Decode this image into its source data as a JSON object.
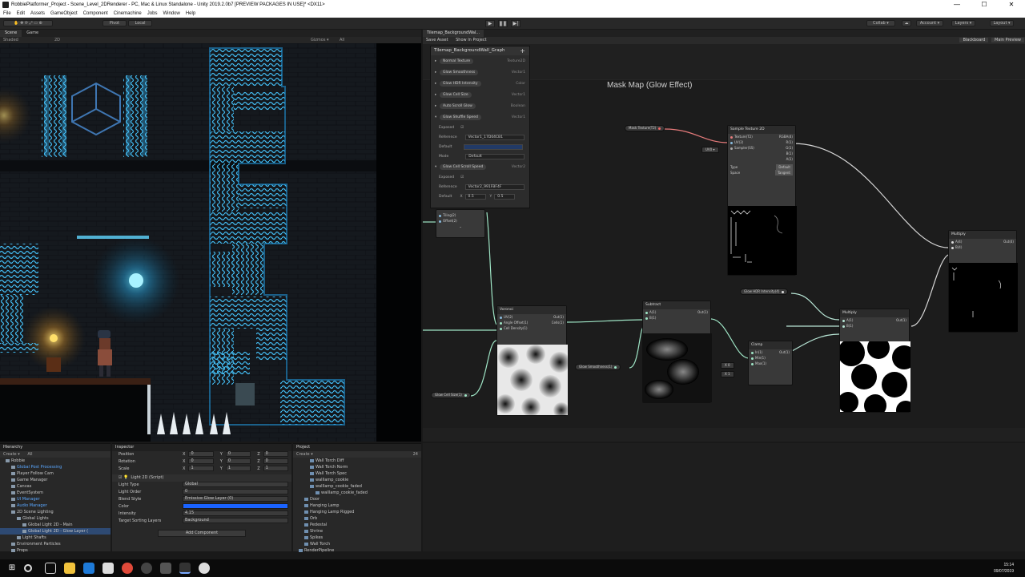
{
  "window": {
    "title": "RobbiePlatformer_Project - Scene_Level_2DRenderer - PC, Mac & Linux Standalone - Unity 2019.2.0b7 [PREVIEW PACKAGES IN USE]* <DX11>",
    "min": "—",
    "max": "☐",
    "close": "✕"
  },
  "menu": [
    "File",
    "Edit",
    "Assets",
    "GameObject",
    "Component",
    "Cinemachine",
    "Jobs",
    "Window",
    "Help"
  ],
  "toolbar": {
    "pivot": "Pivot",
    "local": "Local",
    "play": "▶",
    "pause": "❚❚",
    "step": "▶|",
    "collab": "Collab ▾",
    "account": "Account ▾",
    "layers": "Layers ▾",
    "layout": "Layout ▾"
  },
  "scene": {
    "tab_scene": "Scene",
    "tab_game": "Game",
    "shaded": "Shaded",
    "mode_2d": "2D",
    "gizmos": "Gizmos ▾",
    "search": "All"
  },
  "shader_graph": {
    "tab": "Tilemap_BackgroundWal...",
    "save": "Save Asset",
    "show": "Show In Project",
    "blackboard_btn": "Blackboard",
    "preview_btn": "Main Preview",
    "group_title": "Mask Map (Glow Effect)"
  },
  "blackboard": {
    "title": "Tilemap_BackgroundWall_Graph",
    "subtitle": "Shader Graphs",
    "plus": "+",
    "props": [
      {
        "name": "Normal Texture",
        "type": "Texture2D"
      },
      {
        "name": "Glow Smoothness",
        "type": "Vector1"
      },
      {
        "name": "Glow HDR Intensity",
        "type": "Color"
      },
      {
        "name": "Glow Cell Size",
        "type": "Vector1"
      },
      {
        "name": "Auto Scroll Glow",
        "type": "Boolean"
      },
      {
        "name": "Glow Shuffle Speed",
        "type": "Vector1"
      }
    ],
    "exposed": "Exposed",
    "reference": "Reference",
    "ref1": "Vector1_17D04CB1",
    "default": "Default",
    "mode": "Mode",
    "mode_val": "Default",
    "prop7": {
      "name": "Glow Cell Scroll Speed",
      "type": "Vector2"
    },
    "ref2": "Vector2_991FBF4F",
    "x": "X",
    "xval": "0.5",
    "y": "Y",
    "yval": "0.5"
  },
  "nodes": {
    "sample": {
      "title": "Sample Texture 2D",
      "texture": "Texture(T2)",
      "uv": "UV(2)",
      "sampler": "Sampler(SS)",
      "rgba": "RGBA(4)",
      "r": "R(1)",
      "g": "G(1)",
      "b": "B(1)",
      "a": "A(1)",
      "type": "Type",
      "type_val": "Default",
      "space": "Space",
      "space_val": "Tangent"
    },
    "voronoi": {
      "title": "Voronoi",
      "uv": "UV(2)",
      "angle": "Angle Offset(1)",
      "density": "Cell Density(1)",
      "out": "Out(1)",
      "cells": "Cells(1)"
    },
    "subtract": {
      "title": "Subtract",
      "a": "A(1)",
      "b": "B(1)",
      "out": "Out(1)"
    },
    "clamp": {
      "title": "Clamp",
      "in": "In(1)",
      "min": "Min(1)",
      "max": "Max(1)",
      "out": "Out(1)"
    },
    "multiply1": {
      "title": "Multiply",
      "a": "A(1)",
      "b": "B(1)",
      "out": "Out(1)"
    },
    "multiply2": {
      "title": "Multiply",
      "a": "A(4)",
      "b": "B(4)",
      "out": "Out(4)"
    },
    "tiling": {
      "tiling": "Tiling(2)",
      "offset": "Offset(2)"
    }
  },
  "pills": {
    "mask": "Mask Texture(T2)",
    "hdr": "Glow HDR Intensity(4)",
    "smooth": "Glow Smoothness(1)",
    "cellsize": "Glow Cell Size(1)",
    "uv0": "UV0 ▾",
    "x0": "X 0",
    "x1": "X 1"
  },
  "hierarchy": {
    "tab": "Hierarchy",
    "create": "Create ▾",
    "search": "All",
    "items": [
      {
        "label": "Robbie",
        "indent": 1,
        "style": ""
      },
      {
        "label": "Global Post Processing",
        "indent": 2,
        "style": "blue"
      },
      {
        "label": "Player Follow Cam",
        "indent": 2,
        "style": ""
      },
      {
        "label": "Game Manager",
        "indent": 2,
        "style": ""
      },
      {
        "label": "Canvas",
        "indent": 2,
        "style": ""
      },
      {
        "label": "EventSystem",
        "indent": 2,
        "style": ""
      },
      {
        "label": "UI Manager",
        "indent": 2,
        "style": "blue"
      },
      {
        "label": "Audio Manager",
        "indent": 2,
        "style": "blue"
      },
      {
        "label": "2D Scene Lighting",
        "indent": 2,
        "style": ""
      },
      {
        "label": "Global Lights",
        "indent": 3,
        "style": ""
      },
      {
        "label": "Global Light 2D - Main",
        "indent": 4,
        "style": ""
      },
      {
        "label": "Global Light 2D - Glow Layer (",
        "indent": 4,
        "style": "sel"
      },
      {
        "label": "Light Shafts",
        "indent": 3,
        "style": ""
      },
      {
        "label": "Environment Particles",
        "indent": 2,
        "style": ""
      },
      {
        "label": "Props",
        "indent": 2,
        "style": ""
      }
    ]
  },
  "inspector": {
    "tab": "Inspector",
    "position": "Position",
    "rotation": "Rotation",
    "scale": "Scale",
    "x": "X",
    "y": "Y",
    "z": "Z",
    "pos": [
      "0",
      "0",
      "0"
    ],
    "rot": [
      "0",
      "0",
      "0"
    ],
    "scl": [
      "1",
      "1",
      "1"
    ],
    "component": "Light 2D (Script)",
    "light_type": "Light Type",
    "light_type_val": "Global",
    "light_order": "Light Order",
    "light_order_val": "0",
    "blend_style": "Blend Style",
    "blend_style_val": "Emissive Glow Layer (0)",
    "color": "Color",
    "color_val": "#1a63ff",
    "intensity": "Intensity",
    "intensity_val": "4.15",
    "sorting": "Target Sorting Layers",
    "sorting_val": "Background",
    "add_component": "Add Component"
  },
  "project": {
    "tab": "Project",
    "create": "Create ▾",
    "items": [
      {
        "label": "Wall Torch Diff",
        "indent": 3
      },
      {
        "label": "Wall Torch Norm",
        "indent": 3
      },
      {
        "label": "Wall Torch Spec",
        "indent": 3
      },
      {
        "label": "walllamp_cookie",
        "indent": 3
      },
      {
        "label": "walllamp_cookie_faded",
        "indent": 3
      },
      {
        "label": "walllamp_cookie_faded",
        "indent": 4
      },
      {
        "label": "Door",
        "indent": 2
      },
      {
        "label": "Hanging Lamp",
        "indent": 2
      },
      {
        "label": "Hanging Lamp Rigged",
        "indent": 2
      },
      {
        "label": "Orb",
        "indent": 2
      },
      {
        "label": "Pedestal",
        "indent": 2
      },
      {
        "label": "Shrine",
        "indent": 2
      },
      {
        "label": "Spikes",
        "indent": 2
      },
      {
        "label": "Wall Torch",
        "indent": 2
      },
      {
        "label": "RenderPipeline",
        "indent": 1
      }
    ],
    "count": "24"
  },
  "taskbar": {
    "time": "15:14",
    "date": "09/07/2019"
  },
  "colors": {
    "accent_blue": "#5aa7ff",
    "neon": "#2fb8ff",
    "bg": "#191919"
  }
}
